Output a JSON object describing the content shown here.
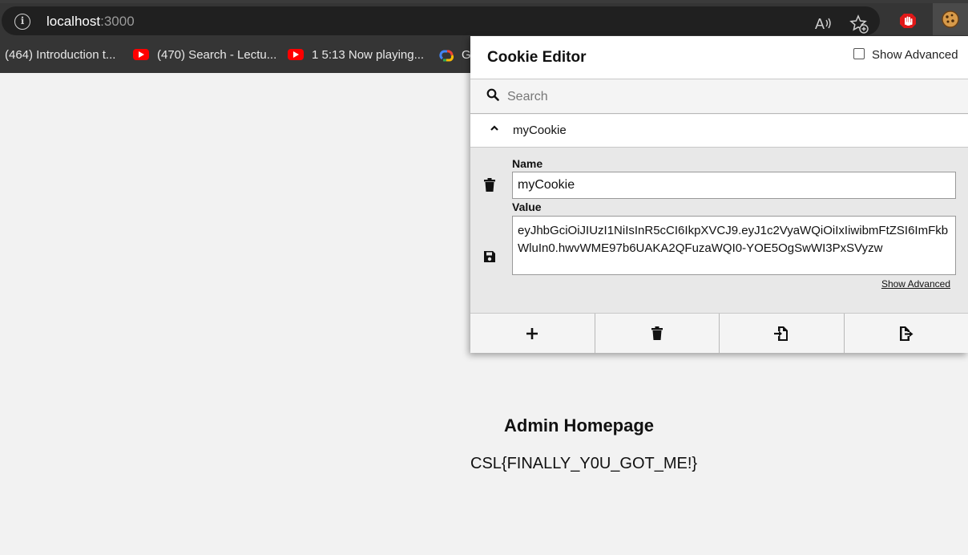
{
  "browser": {
    "url_host": "localhost",
    "url_port": ":3000",
    "bookmarks": [
      {
        "label": "(464) Introduction t..."
      },
      {
        "label": "(470) Search - Lectu..."
      },
      {
        "label": "1 5:13 Now playing..."
      },
      {
        "label": "G"
      }
    ],
    "icons": [
      "info-icon",
      "read-aloud-icon",
      "add-favorite-icon",
      "stop-hand-extension-icon",
      "cookie-extension-icon",
      "youtube-icon",
      "google-cloud-icon"
    ]
  },
  "popup": {
    "title": "Cookie Editor",
    "show_advanced_label": "Show Advanced",
    "search_placeholder": "Search",
    "cookie": {
      "name": "myCookie",
      "name_label": "Name",
      "value_label": "Value",
      "value": "eyJhbGciOiJIUzI1NiIsInR5cCI6IkpXVCJ9.eyJ1c2VyaWQiOiIxIiwibmFtZSI6ImFkbWluIn0.hwvWME97b6UAKA2QFuzaWQI0-YOE5OgSwWI3PxSVyzw",
      "show_advanced_link": "Show Advanced"
    },
    "actions": [
      "add-icon",
      "delete-all-icon",
      "import-icon",
      "export-icon"
    ]
  },
  "page": {
    "heading": "Admin Homepage",
    "flag_text": "CSL{FINALLY_Y0U_GOT_ME!}"
  }
}
